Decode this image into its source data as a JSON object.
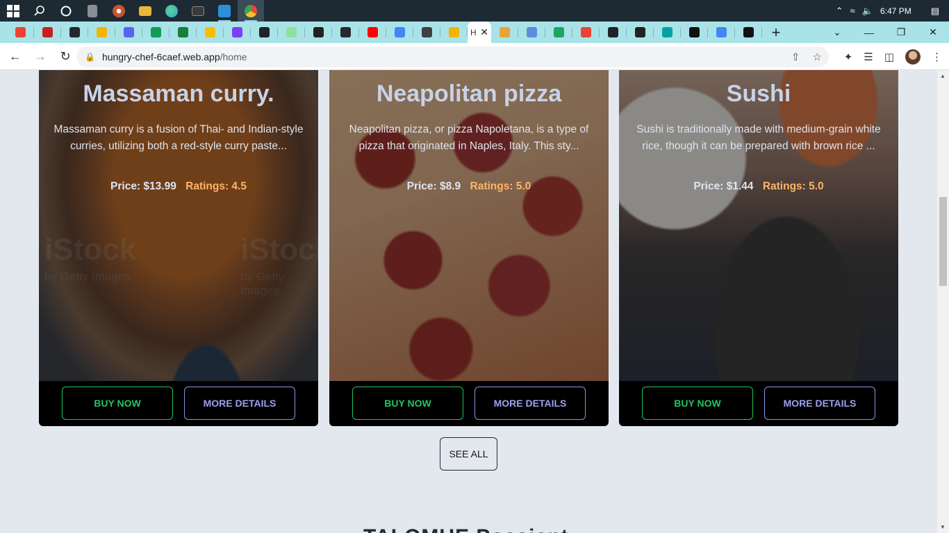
{
  "taskbar": {
    "icons": [
      {
        "name": "windows-start-icon",
        "color": "#ffffff"
      },
      {
        "name": "search-icon",
        "color": "#ffffff"
      },
      {
        "name": "cortana-icon",
        "color": "#ffffff"
      },
      {
        "name": "calculator-icon",
        "color": "#8a8f96"
      },
      {
        "name": "media-player-icon",
        "color": "#c9542f"
      },
      {
        "name": "file-explorer-icon",
        "color": "#e9b83a"
      },
      {
        "name": "edge-icon",
        "color": "#2ea8e0"
      },
      {
        "name": "terminal-icon",
        "color": "#3a3a3a"
      },
      {
        "name": "vscode-icon",
        "color": "#2b90d9"
      },
      {
        "name": "chrome-icon",
        "color": "#e94b35"
      }
    ],
    "time": "6:47 PM"
  },
  "browser": {
    "tabs": [
      {
        "name": "gmail-tab-icon",
        "color": "#ea4335"
      },
      {
        "name": "gmail-tab-icon",
        "color": "#c5221f"
      },
      {
        "name": "github-tab-icon",
        "color": "#24292f"
      },
      {
        "name": "slides-tab-icon",
        "color": "#f4b400"
      },
      {
        "name": "discord-tab-icon",
        "color": "#5865f2"
      },
      {
        "name": "sheets-tab-icon",
        "color": "#0f9d58"
      },
      {
        "name": "sheets-tab-icon",
        "color": "#188038"
      },
      {
        "name": "slides-tab-icon",
        "color": "#fbbc04"
      },
      {
        "name": "forms-tab-icon",
        "color": "#7e3ff2"
      },
      {
        "name": "react-tab-icon",
        "color": "#20232a"
      },
      {
        "name": "chat-tab-icon",
        "color": "#8ee0a0"
      },
      {
        "name": "globe-tab-icon",
        "color": "#222222"
      },
      {
        "name": "github-tab-icon",
        "color": "#24292f"
      },
      {
        "name": "youtube-tab-icon",
        "color": "#ff0000"
      },
      {
        "name": "google-tab-icon",
        "color": "#4285f4"
      },
      {
        "name": "graduation-cap-tab-icon",
        "color": "#3c4043"
      },
      {
        "name": "flower-tab-icon",
        "color": "#f4b400"
      }
    ],
    "tabs_after": [
      {
        "name": "feather-tab-icon",
        "color": "#e8a33a"
      },
      {
        "name": "lvl-tab-icon",
        "color": "#5b8dd9"
      },
      {
        "name": "drive-tab-icon",
        "color": "#1fa463"
      },
      {
        "name": "arrow-tab-icon",
        "color": "#e94335"
      },
      {
        "name": "react-tab-icon",
        "color": "#20232a"
      },
      {
        "name": "globe-tab-icon",
        "color": "#222222"
      },
      {
        "name": "diamond-tab-icon",
        "color": "#00a3a3"
      },
      {
        "name": "m-tab-icon",
        "color": "#111111"
      },
      {
        "name": "google-tab-icon",
        "color": "#4285f4"
      },
      {
        "name": "m-tab-icon",
        "color": "#111111"
      }
    ],
    "active_tab_label": "H",
    "url_host": "hungry-chef-6caef.web.app",
    "url_path": "/home"
  },
  "cards": [
    {
      "title": "Massaman curry.",
      "description": "Massaman curry is a fusion of Thai- and Indian-style curries, utilizing both a red-style curry paste...",
      "price": "Price: $13.99",
      "rating": "Ratings: 4.5",
      "buy_label": "BUY NOW",
      "details_label": "MORE DETAILS",
      "watermark": "iStock",
      "watermark_sub": "by Getty Images"
    },
    {
      "title": "Neapolitan pizza",
      "description": "Neapolitan pizza, or pizza Napoletana, is a type of pizza that originated in Naples, Italy. This sty...",
      "price": "Price: $8.9",
      "rating": "Ratings: 5.0",
      "buy_label": "BUY NOW",
      "details_label": "MORE DETAILS"
    },
    {
      "title": "Sushi",
      "description": "Sushi is traditionally made with medium-grain white rice, though it can be prepared with brown rice ...",
      "price": "Price: $1.44",
      "rating": "Ratings: 5.0",
      "buy_label": "BUY NOW",
      "details_label": "MORE DETAILS"
    }
  ],
  "see_all_label": "SEE ALL",
  "next_section_heading": "TALOMUE Pocsient"
}
